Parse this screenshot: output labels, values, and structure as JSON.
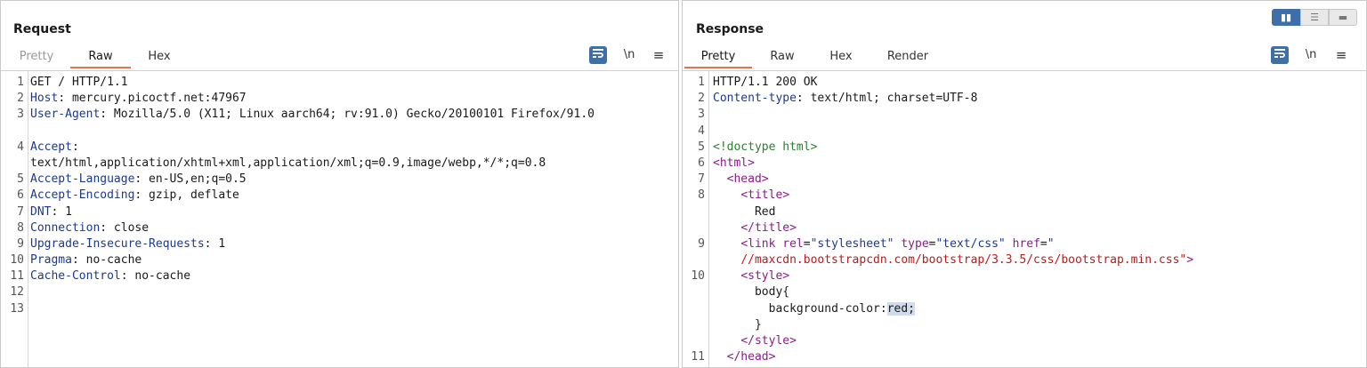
{
  "request": {
    "title": "Request",
    "tabs": [
      "Pretty",
      "Raw",
      "Hex"
    ],
    "active_tab": "Raw",
    "toolbar": {
      "wrap_icon": "word-wrap-icon",
      "newline_label": "\\n",
      "menu_icon": "≡"
    },
    "lines": [
      {
        "n": "1",
        "t": "GET / HTTP/1.1"
      },
      {
        "n": "2",
        "k": "Host",
        "v": ": mercury.picoctf.net:47967"
      },
      {
        "n": "3",
        "k": "User-Agent",
        "v": ": Mozilla/5.0 (X11; Linux aarch64; rv:91.0) Gecko/20100101 Firefox/91.0"
      },
      {
        "n": "4",
        "k": "Accept",
        "v": ":\ntext/html,application/xhtml+xml,application/xml;q=0.9,image/webp,*/*;q=0.8"
      },
      {
        "n": "5",
        "k": "Accept-Language",
        "v": ": en-US,en;q=0.5"
      },
      {
        "n": "6",
        "k": "Accept-Encoding",
        "v": ": gzip, deflate"
      },
      {
        "n": "7",
        "k": "DNT",
        "v": ": 1"
      },
      {
        "n": "8",
        "k": "Connection",
        "v": ": close"
      },
      {
        "n": "9",
        "k": "Upgrade-Insecure-Requests",
        "v": ": 1"
      },
      {
        "n": "10",
        "k": "Pragma",
        "v": ": no-cache"
      },
      {
        "n": "11",
        "k": "Cache-Control",
        "v": ": no-cache"
      },
      {
        "n": "12",
        "t": ""
      },
      {
        "n": "13",
        "t": ""
      }
    ]
  },
  "response": {
    "title": "Response",
    "tabs": [
      "Pretty",
      "Raw",
      "Hex",
      "Render"
    ],
    "active_tab": "Pretty",
    "toolbar": {
      "wrap_icon": "word-wrap-icon",
      "newline_label": "\\n",
      "menu_icon": "≡"
    },
    "layout_toggle": [
      "split-vertical-icon",
      "split-horizontal-icon",
      "single-pane-icon"
    ],
    "status_line": "HTTP/1.1 200 OK",
    "content_type_key": "Content-type",
    "content_type_val": ": text/html; charset=UTF-8",
    "doctype": "<!doctype html>",
    "title_text": "Red",
    "link_rel": "\"stylesheet\"",
    "link_type": "\"text/css\"",
    "link_href": "\"",
    "link_href_cont": "//maxcdn.bootstrapcdn.com/bootstrap/3.3.5/css/bootstrap.min.css\"",
    "css_selector": "body{",
    "css_prop": "background-color:",
    "css_val": "red;",
    "css_close": "}",
    "line_numbers": [
      "1",
      "2",
      "3",
      "4",
      "5",
      "6",
      "7",
      "8",
      "",
      "",
      "9",
      "",
      "10",
      "",
      "",
      "",
      "",
      "11"
    ]
  },
  "colors": {
    "accent": "#e8724a",
    "toggle_active": "#3f6fa8",
    "header_key": "#1b3a8c",
    "tag": "#8a1c8a",
    "string": "#b71c1c",
    "doctype": "#2e7d32"
  }
}
